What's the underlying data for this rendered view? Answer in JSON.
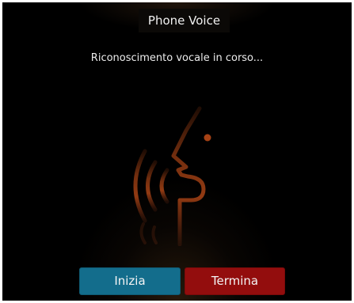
{
  "window": {
    "title": "Phone Voice"
  },
  "status_text": "Riconoscimento vocale in corso...",
  "graphic": {
    "icon": "speaking-head-icon",
    "color": "#d0531a"
  },
  "buttons": {
    "start_label": "Inizia",
    "stop_label": "Termina",
    "start_color": "#136d8c",
    "stop_color": "#930d0d"
  }
}
